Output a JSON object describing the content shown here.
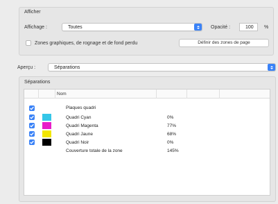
{
  "afficher": {
    "section_title": "Afficher",
    "affichage_label": "Affichage :",
    "affichage_value": "Toutes",
    "opacite_label": "Opacité :",
    "opacite_value": "100",
    "opacite_unit": "%",
    "zones_checkbox_label": "Zones graphiques, de rognage et de fond perdu",
    "zones_checked": false,
    "definir_button": "Définir des zones de page"
  },
  "apercu": {
    "label": "Aperçu :",
    "value": "Séparations"
  },
  "separations": {
    "section_title": "Séparations",
    "column_header_nom": "Nom",
    "rows": [
      {
        "name": "Plaques quadri",
        "value": "",
        "checked": true,
        "swatch": ""
      },
      {
        "name": "Quadri Cyan",
        "value": "0%",
        "checked": true,
        "swatch": "#35c6e8"
      },
      {
        "name": "Quadri Magenta",
        "value": "77%",
        "checked": true,
        "swatch": "#e81dc8"
      },
      {
        "name": "Quadri Jaune",
        "value": "68%",
        "checked": true,
        "swatch": "#f2e600"
      },
      {
        "name": "Quadri Noir",
        "value": "0%",
        "checked": true,
        "swatch": "#000000"
      },
      {
        "name": "Couverture totale de la zone",
        "value": "145%",
        "checked": false,
        "swatch": ""
      }
    ]
  },
  "colors": {
    "accent": "#3a82f7"
  }
}
